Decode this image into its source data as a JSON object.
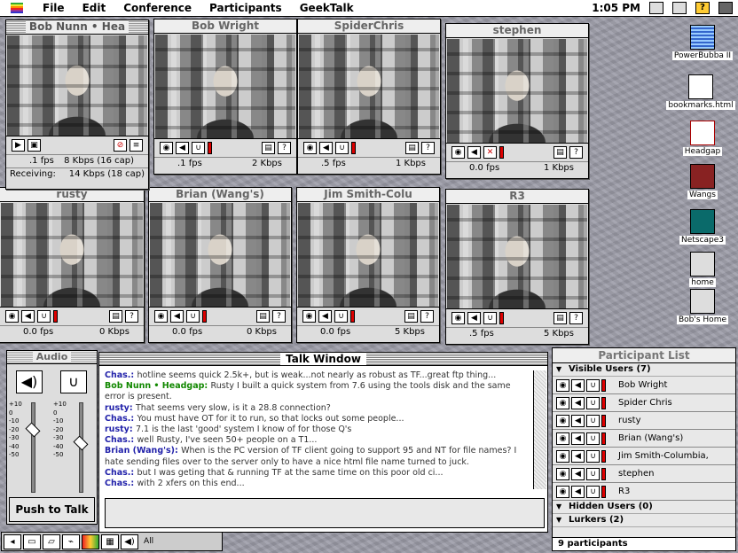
{
  "menubar": {
    "items": [
      "File",
      "Edit",
      "Conference",
      "Participants",
      "GeekTalk"
    ],
    "clock": "1:05 PM"
  },
  "video_windows": [
    {
      "name": "Bob Nunn • Hea",
      "fps": ".1 fps",
      "rate": "8 Kbps (16 cap)",
      "receiving_label": "Receiving:",
      "receiving": "14 Kbps (18 cap)"
    },
    {
      "name": "Bob Wright",
      "fps": ".1 fps",
      "rate": "2 Kbps"
    },
    {
      "name": "SpiderChris",
      "fps": ".5 fps",
      "rate": "1 Kbps"
    },
    {
      "name": "stephen",
      "fps": "0.0 fps",
      "rate": "1 Kbps"
    },
    {
      "name": "rusty",
      "fps": "0.0 fps",
      "rate": "0 Kbps"
    },
    {
      "name": "Brian (Wang's)",
      "fps": "0.0 fps",
      "rate": "0 Kbps"
    },
    {
      "name": "Jim Smith-Colu",
      "fps": "0.0 fps",
      "rate": "5 Kbps"
    },
    {
      "name": "R3",
      "fps": ".5 fps",
      "rate": "5 Kbps"
    }
  ],
  "desktop_icons": [
    "PowerBubba II",
    "bookmarks.html",
    "Headgap",
    "Wangs",
    "Netscape3",
    "home",
    "Bob's Home"
  ],
  "audio": {
    "title": "Audio",
    "scale": [
      "+10",
      "0",
      "-10",
      "-20",
      "-30",
      "-40",
      "-50"
    ],
    "push_to_talk": "Push to Talk",
    "mic_level": 0.45,
    "speaker_level": 0.28
  },
  "talk": {
    "title": "Talk Window",
    "messages": [
      {
        "who": "Chas.",
        "text": "hotline seems quick 2.5k+, but is weak...not nearly as robust as TF...great ftp thing...",
        "green": false
      },
      {
        "who": "Bob Nunn • Headgap",
        "text": "Rusty I built a quick system from 7.6 using the tools disk and the same error is present.",
        "green": true
      },
      {
        "who": "rusty",
        "text": "That seems very slow, is it a 28.8 connection?",
        "green": false
      },
      {
        "who": "Chas.",
        "text": "You must have OT for it to run, so that locks out some people...",
        "green": false
      },
      {
        "who": "rusty",
        "text": "7.1 is the last 'good' system I know of for those Q's",
        "green": false
      },
      {
        "who": "Chas.",
        "text": "well Rusty, I've seen 50+ people on a T1...",
        "green": false
      },
      {
        "who": "Brian (Wang's)",
        "text": "When is the PC version of TF client going to support 95 and NT for file names? I hate sending files over to the server only to have a nice html file name turned to juck.",
        "green": false
      },
      {
        "who": "Chas.",
        "text": "but I was geting that & running TF at the same time on this poor old ci...",
        "green": false
      },
      {
        "who": "Chas.",
        "text": "with 2 xfers on this end...",
        "green": false
      }
    ]
  },
  "participants": {
    "title": "Participant List",
    "visible_label": "Visible Users (7)",
    "visible": [
      "Bob Wright",
      "Spider Chris",
      "rusty",
      "Brian (Wang's)",
      "Jim Smith-Columbia,",
      "stephen",
      "R3"
    ],
    "hidden_label": "Hidden Users (0)",
    "lurkers_label": "Lurkers (2)",
    "count": "9 participants"
  },
  "taskbar": {
    "label": "All"
  }
}
